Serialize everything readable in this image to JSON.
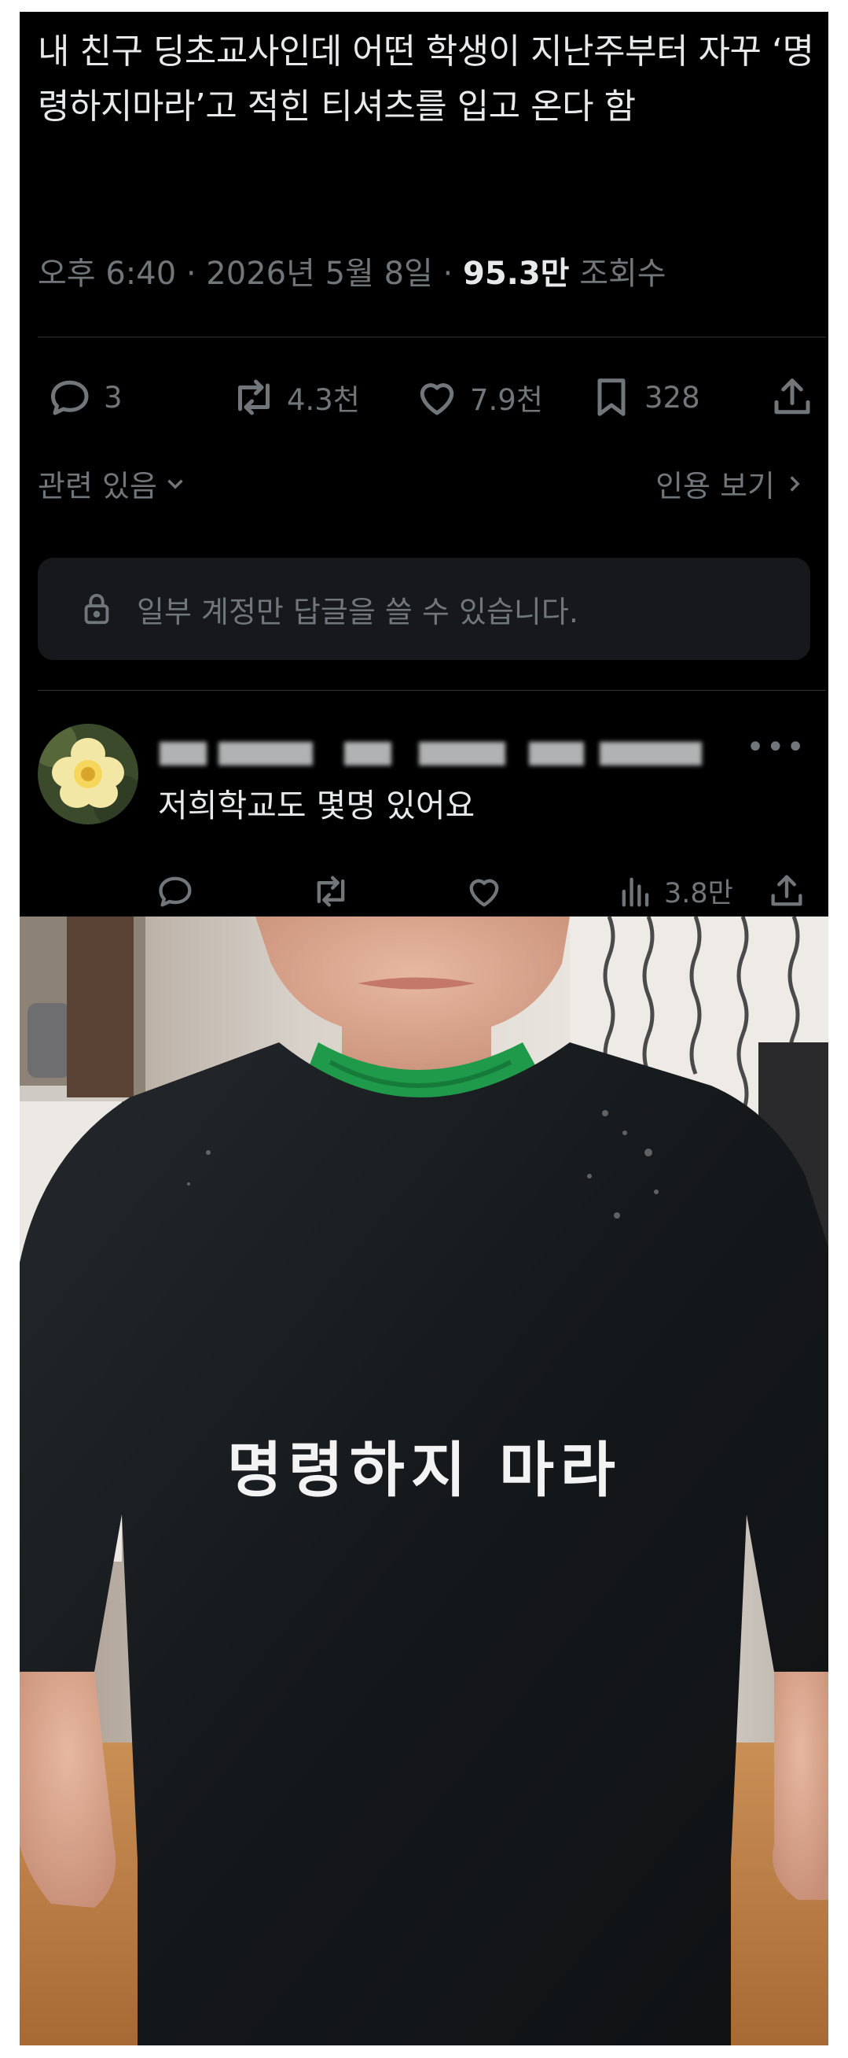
{
  "tweet": {
    "text": "내 친구 딩초교사인데 어떤 학생이 지난주부터 자꾸 ‘명령하지마라’고 적힌 티셔츠를 입고 온다 함",
    "time": "오후 6:40",
    "date": "2026년 5월 8일",
    "views_count": "95.3만",
    "views_label": "조회수",
    "actions": {
      "replies": "3",
      "reposts": "4.3천",
      "likes": "7.9천",
      "bookmarks": "328"
    },
    "related_label": "관련 있음",
    "quotes_label": "인용 보기",
    "reply_restriction": "일부 계정만 답글을 쓸 수 있습니다."
  },
  "reply": {
    "text": "저희학교도 몇명 있어요",
    "views": "3.8만"
  },
  "photo": {
    "shirt_text": "명령하지 마라"
  },
  "icons": [
    "reply-icon",
    "repost-icon",
    "like-icon",
    "bookmark-icon",
    "share-icon",
    "chevron-down-icon",
    "chevron-right-icon",
    "lock-icon",
    "views-icon",
    "more-icon"
  ],
  "colors": {
    "background": "#000000",
    "text_primary": "#e7e9ea",
    "text_secondary": "#71767b",
    "divider": "#2f3336",
    "reply_box": "#16181c",
    "undershirt": "#1f9a4a"
  }
}
